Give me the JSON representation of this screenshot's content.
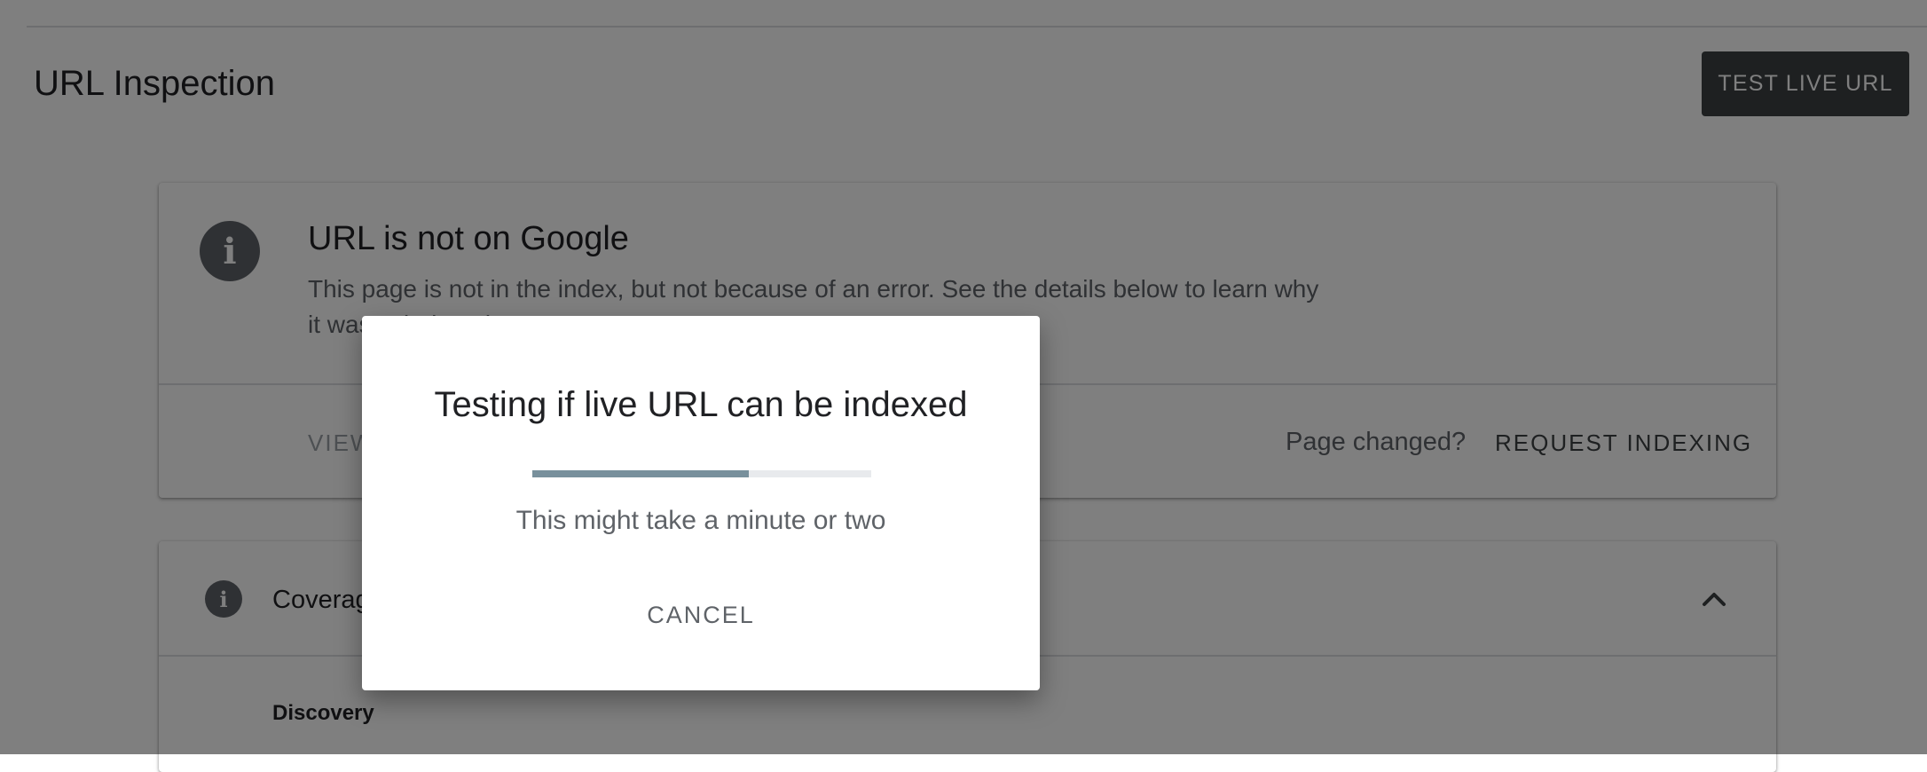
{
  "header": {
    "title": "URL Inspection",
    "test_live_url_label": "TEST LIVE URL"
  },
  "status_card": {
    "icon": "info-icon",
    "title": "URL is not on Google",
    "description": "This page is not in the index, but not because of an error. See the details below to learn why it wasn't indexed.",
    "view_link": "VIEW CRAWLED PAGE",
    "page_changed": "Page changed?",
    "request_indexing": "REQUEST INDEXING"
  },
  "coverage_card": {
    "icon": "info-icon",
    "label": "Coverage",
    "chevron": "chevron-up-icon",
    "sub_section": "Discovery"
  },
  "dialog": {
    "title": "Testing if live URL can be indexed",
    "progress": 0.64,
    "subtitle": "This might take a minute or two",
    "cancel_label": "CANCEL"
  },
  "colors": {
    "progress_fill": "#78909c",
    "progress_track": "#e8eaed",
    "dark_button": "#3c4043",
    "scrim": "rgba(0,0,0,0.5)"
  }
}
